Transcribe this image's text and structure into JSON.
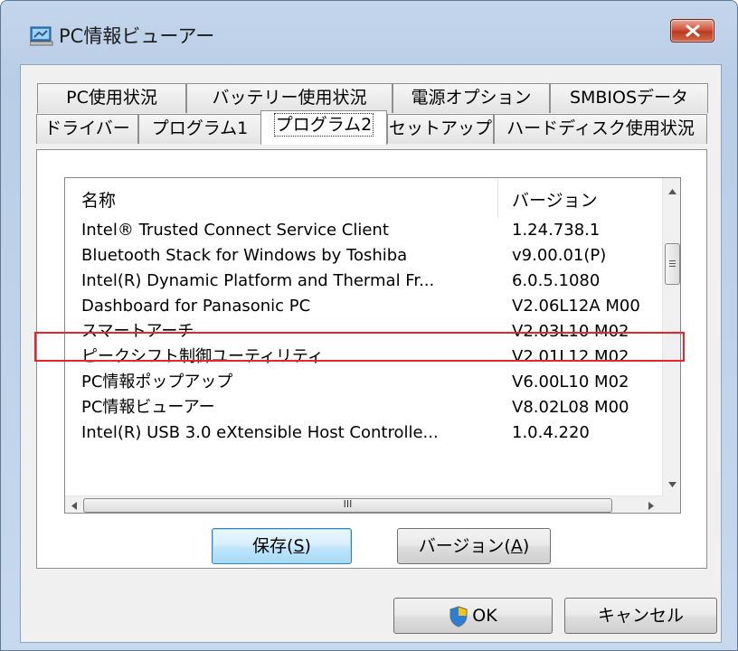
{
  "window": {
    "title": "PC情報ビューアー"
  },
  "tabs_row1": [
    "PC使用状況",
    "バッテリー使用状況",
    "電源オプション",
    "SMBIOSデータ"
  ],
  "tabs_row2": [
    "ドライバー",
    "プログラム1",
    "プログラム2",
    "セットアップ",
    "ハードディスク使用状況"
  ],
  "selected_tab": "プログラム2",
  "list": {
    "columns": {
      "name": "名称",
      "version": "バージョン"
    },
    "rows": [
      {
        "name": "Intel® Trusted Connect Service Client",
        "version": "1.24.738.1"
      },
      {
        "name": "Bluetooth Stack for Windows by Toshiba",
        "version": "v9.00.01(P)"
      },
      {
        "name": "Intel(R) Dynamic Platform and Thermal Fr...",
        "version": "6.0.5.1080"
      },
      {
        "name": "Dashboard for Panasonic PC",
        "version": "V2.06L12A M00"
      },
      {
        "name": "スマートアーチ",
        "version": "V2.03L10 M02"
      },
      {
        "name": "ピークシフト制御ユーティリティ",
        "version": "V2.01L12 M02"
      },
      {
        "name": "PC情報ポップアップ",
        "version": "V6.00L10 M02"
      },
      {
        "name": "PC情報ビューアー",
        "version": "V8.02L08 M00"
      },
      {
        "name": "Intel(R) USB 3.0 eXtensible Host Controlle...",
        "version": "1.0.4.220"
      }
    ],
    "highlighted_row_index": 4,
    "hscroll_thumb_label": "III"
  },
  "buttons": {
    "save": {
      "label": "保存(",
      "mnemonic": "S",
      "suffix": ")"
    },
    "version": {
      "label": "バージョン(",
      "mnemonic": "A",
      "suffix": ")"
    },
    "ok": "OK",
    "cancel": "キャンセル"
  },
  "colors": {
    "highlight": "#e8262a",
    "default_button": "#3c7fb1",
    "close_button": "#c9452a"
  }
}
